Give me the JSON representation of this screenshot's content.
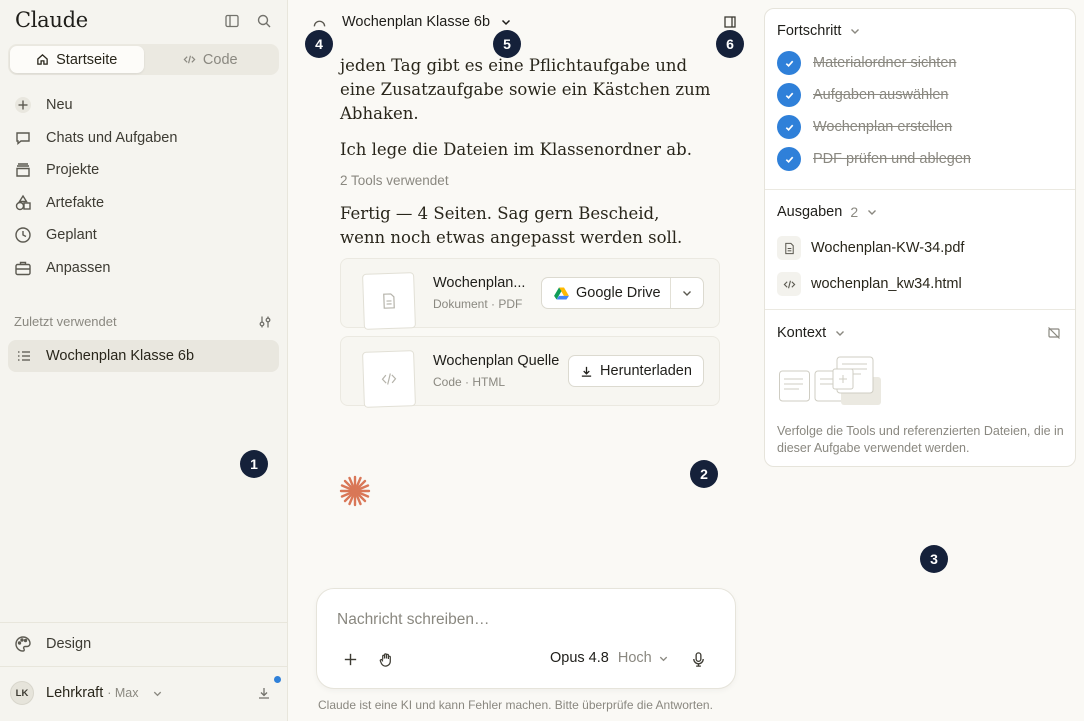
{
  "sidebar": {
    "logo": "Claude",
    "tabs": [
      "Startseite",
      "Code"
    ],
    "nav": [
      "Neu",
      "Chats und Aufgaben",
      "Projekte",
      "Artefakte",
      "Geplant",
      "Anpassen"
    ],
    "recent_label": "Zuletzt verwendet",
    "recent_item": "Wochenplan Klasse 6b",
    "design": "Design",
    "user": {
      "initials": "LK",
      "name": "Lehrkraft",
      "plan": "· Max"
    }
  },
  "markers": [
    "1",
    "2",
    "3",
    "4",
    "5",
    "6"
  ],
  "main": {
    "title": "Wochenplan Klasse 6b",
    "messages": [
      "jeden Tag gibt es eine Pflichtaufgabe und eine Zusatzaufgabe sowie ein Kästchen zum Abhaken.",
      "Ich lege die Dateien im Klassenordner ab.",
      "Fertig — 4 Seiten. Sag gern Bescheid, wenn noch etwas angepasst werden soll."
    ],
    "tools_used": "2 Tools verwendet",
    "artifacts": [
      {
        "title": "Wochenplan...",
        "sub": "Dokument · PDF",
        "action": "Google Drive"
      },
      {
        "title": "Wochenplan Quelle",
        "sub": "Code · HTML",
        "action": "Herunterladen"
      }
    ],
    "composer": {
      "placeholder": "Nachricht schreiben…",
      "model": "Opus 4.8",
      "effort": "Hoch"
    },
    "disclaimer": "Claude ist eine KI und kann Fehler machen. Bitte überprüfe die Antworten."
  },
  "panel": {
    "progress_title": "Fortschritt",
    "tasks": [
      "Materialordner sichten",
      "Aufgaben auswählen",
      "Wochenplan erstellen",
      "PDF prüfen und ablegen"
    ],
    "outputs_title": "Ausgaben",
    "outputs_count": "2",
    "outputs": [
      "Wochenplan-KW-34.pdf",
      "wochenplan_kw34.html"
    ],
    "context_title": "Kontext",
    "context_desc": "Verfolge die Tools und referenzierten Dateien, die in dieser Aufgabe verwendet werden."
  },
  "colors": {
    "accent": "#d97757",
    "check": "#2f80d9",
    "marker": "#15213a"
  }
}
